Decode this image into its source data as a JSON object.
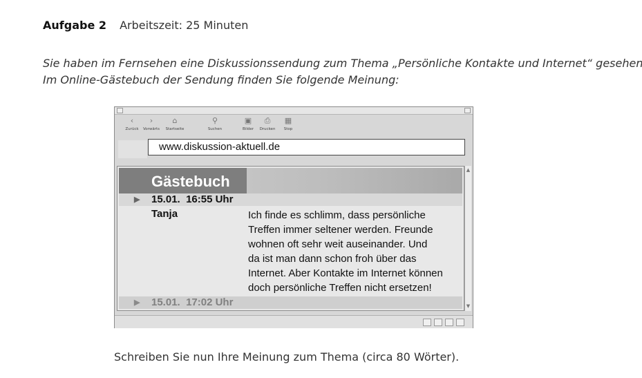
{
  "task": {
    "number": "Aufgabe 2",
    "time": "Arbeitszeit: 25 Minuten"
  },
  "intro": [
    "Sie haben im Fernsehen eine Diskussionssendung zum Thema „Persönliche Kontakte und Internet“ gesehen.",
    "Im Online-Gästebuch der Sendung finden Sie folgende Meinung:"
  ],
  "browser": {
    "toolbar": [
      {
        "label": "Zurück",
        "icon": "back-icon"
      },
      {
        "label": "Vorwärts",
        "icon": "forward-icon"
      },
      {
        "label": "Startseite",
        "icon": "home-icon"
      },
      {
        "label": "Suchen",
        "icon": "search-icon"
      },
      {
        "label": "Bilder",
        "icon": "images-icon"
      },
      {
        "label": "Drucken",
        "icon": "print-icon"
      },
      {
        "label": "Stop",
        "icon": "stop-icon"
      }
    ],
    "url": "www.diskussion-aktuell.de"
  },
  "guestbook": {
    "title": "Gästebuch",
    "entries": [
      {
        "date": "15.01.",
        "time": "16:55 Uhr",
        "author": "Tanja",
        "lines": [
          "Ich finde es schlimm, dass persönliche",
          "Treffen immer seltener werden. Freunde",
          "wohnen oft sehr weit auseinander. Und",
          "da ist man dann schon froh über das",
          "Internet. Aber Kontakte im Internet können",
          "doch persönliche Treffen nicht ersetzen!"
        ]
      },
      {
        "date": "15.01.",
        "time": "17:02 Uhr"
      }
    ]
  },
  "instruction": "Schreiben Sie nun Ihre Meinung zum Thema (circa 80 Wörter)."
}
